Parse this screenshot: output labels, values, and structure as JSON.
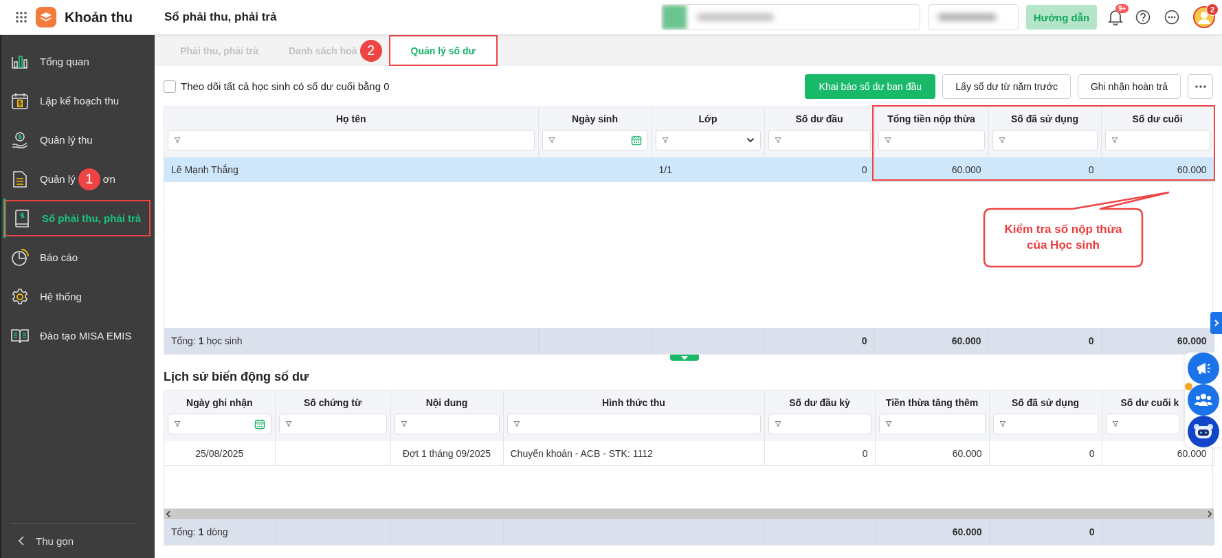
{
  "app": {
    "name": "Khoản thu"
  },
  "page_title": "Sổ phải thu, phải trả",
  "header": {
    "guide_button": "Hướng dẫn",
    "notification_badge": "9+",
    "avatar_badge": "2"
  },
  "sidebar": {
    "items": [
      {
        "label": "Tổng quan",
        "selected": false,
        "highlighted": false
      },
      {
        "label": "Lập kế hoạch thu",
        "selected": false,
        "highlighted": false
      },
      {
        "label": "Quản lý thu",
        "selected": false,
        "highlighted": false
      },
      {
        "label": "Quản lý",
        "label_after": "ơn",
        "marker": "1",
        "selected": false,
        "highlighted": false
      },
      {
        "label": "Sổ phải thu, phải trả",
        "selected": true,
        "highlighted": true
      },
      {
        "label": "Báo cáo",
        "selected": false,
        "highlighted": false
      },
      {
        "label": "Hệ thống",
        "selected": false,
        "highlighted": false
      },
      {
        "label": "Đào tạo MISA EMIS",
        "selected": false,
        "highlighted": false
      }
    ],
    "collapse": "Thu gọn"
  },
  "tabs": [
    {
      "label": "Phải thu, phải trả",
      "selected": false,
      "highlighted": false
    },
    {
      "label": "Danh sách hoà",
      "marker": "2",
      "selected": false,
      "highlighted": false
    },
    {
      "label": "Quản lý số dư",
      "selected": true,
      "highlighted": true
    }
  ],
  "toolbar": {
    "checkbox": {
      "label": "Theo dõi tất cả học sinh có số dư cuối bằng 0",
      "checked": false
    },
    "buttons": [
      {
        "label": "Khai báo số dư ban đầu",
        "kind": "primary"
      },
      {
        "label": "Lấy số dư từ năm trước",
        "kind": "secondary"
      },
      {
        "label": "Ghi nhận hoàn trả",
        "kind": "secondary"
      },
      {
        "kind": "more"
      }
    ]
  },
  "balance_table": {
    "columns": [
      {
        "title": "Họ tên",
        "kind": "text",
        "highlighted": false,
        "total": "Tổng: **1** học sinh"
      },
      {
        "title": "Ngày sinh",
        "kind": "date",
        "highlighted": false
      },
      {
        "title": "Lớp",
        "kind": "select",
        "highlighted": false
      },
      {
        "title": "Số dư đầu",
        "kind": "text",
        "highlighted": false,
        "total": "0"
      },
      {
        "title": "Tổng tiền nộp thừa",
        "kind": "text",
        "highlighted": true,
        "total": "60.000"
      },
      {
        "title": "Số đã sử dụng",
        "kind": "text",
        "highlighted": true,
        "total": "0"
      },
      {
        "title": "Số dư cuối",
        "kind": "text",
        "highlighted": true,
        "total": "60.000"
      }
    ],
    "rows": [
      {
        "selected": true,
        "name": "Lê Mạnh Thắng",
        "class": "1/1",
        "opening_balance": "0",
        "overpaid_total": "60.000",
        "used": "0",
        "closing_balance": "60.000"
      }
    ],
    "callout": "Kiểm tra số nộp thừa của Học sinh"
  },
  "history": {
    "title": "Lịch sử biến động số dư",
    "columns": [
      {
        "title": "Ngày ghi nhận",
        "kind": "date",
        "total": "Tổng: **1** dòng"
      },
      {
        "title": "Số chứng từ",
        "kind": "text"
      },
      {
        "title": "Nội dung",
        "kind": "text"
      },
      {
        "title": "Hình thức thu",
        "kind": "text"
      },
      {
        "title": "Số dư đầu kỳ",
        "kind": "text"
      },
      {
        "title": "Tiền thừa tăng thêm",
        "kind": "text",
        "total": "60.000"
      },
      {
        "title": "Số đã sử dụng",
        "kind": "text",
        "total": "0"
      },
      {
        "title": "Số dư cuối k",
        "kind": "text"
      }
    ],
    "rows": [
      {
        "selected": false,
        "date": "25/08/2025",
        "content": "Đợt 1 tháng 09/2025",
        "method": "Chuyển khoản - ACB - STK: 1112",
        "opening_balance": "0",
        "overpaid_added": "60.000",
        "used": "0",
        "closing_balance": "60.000"
      }
    ]
  }
}
